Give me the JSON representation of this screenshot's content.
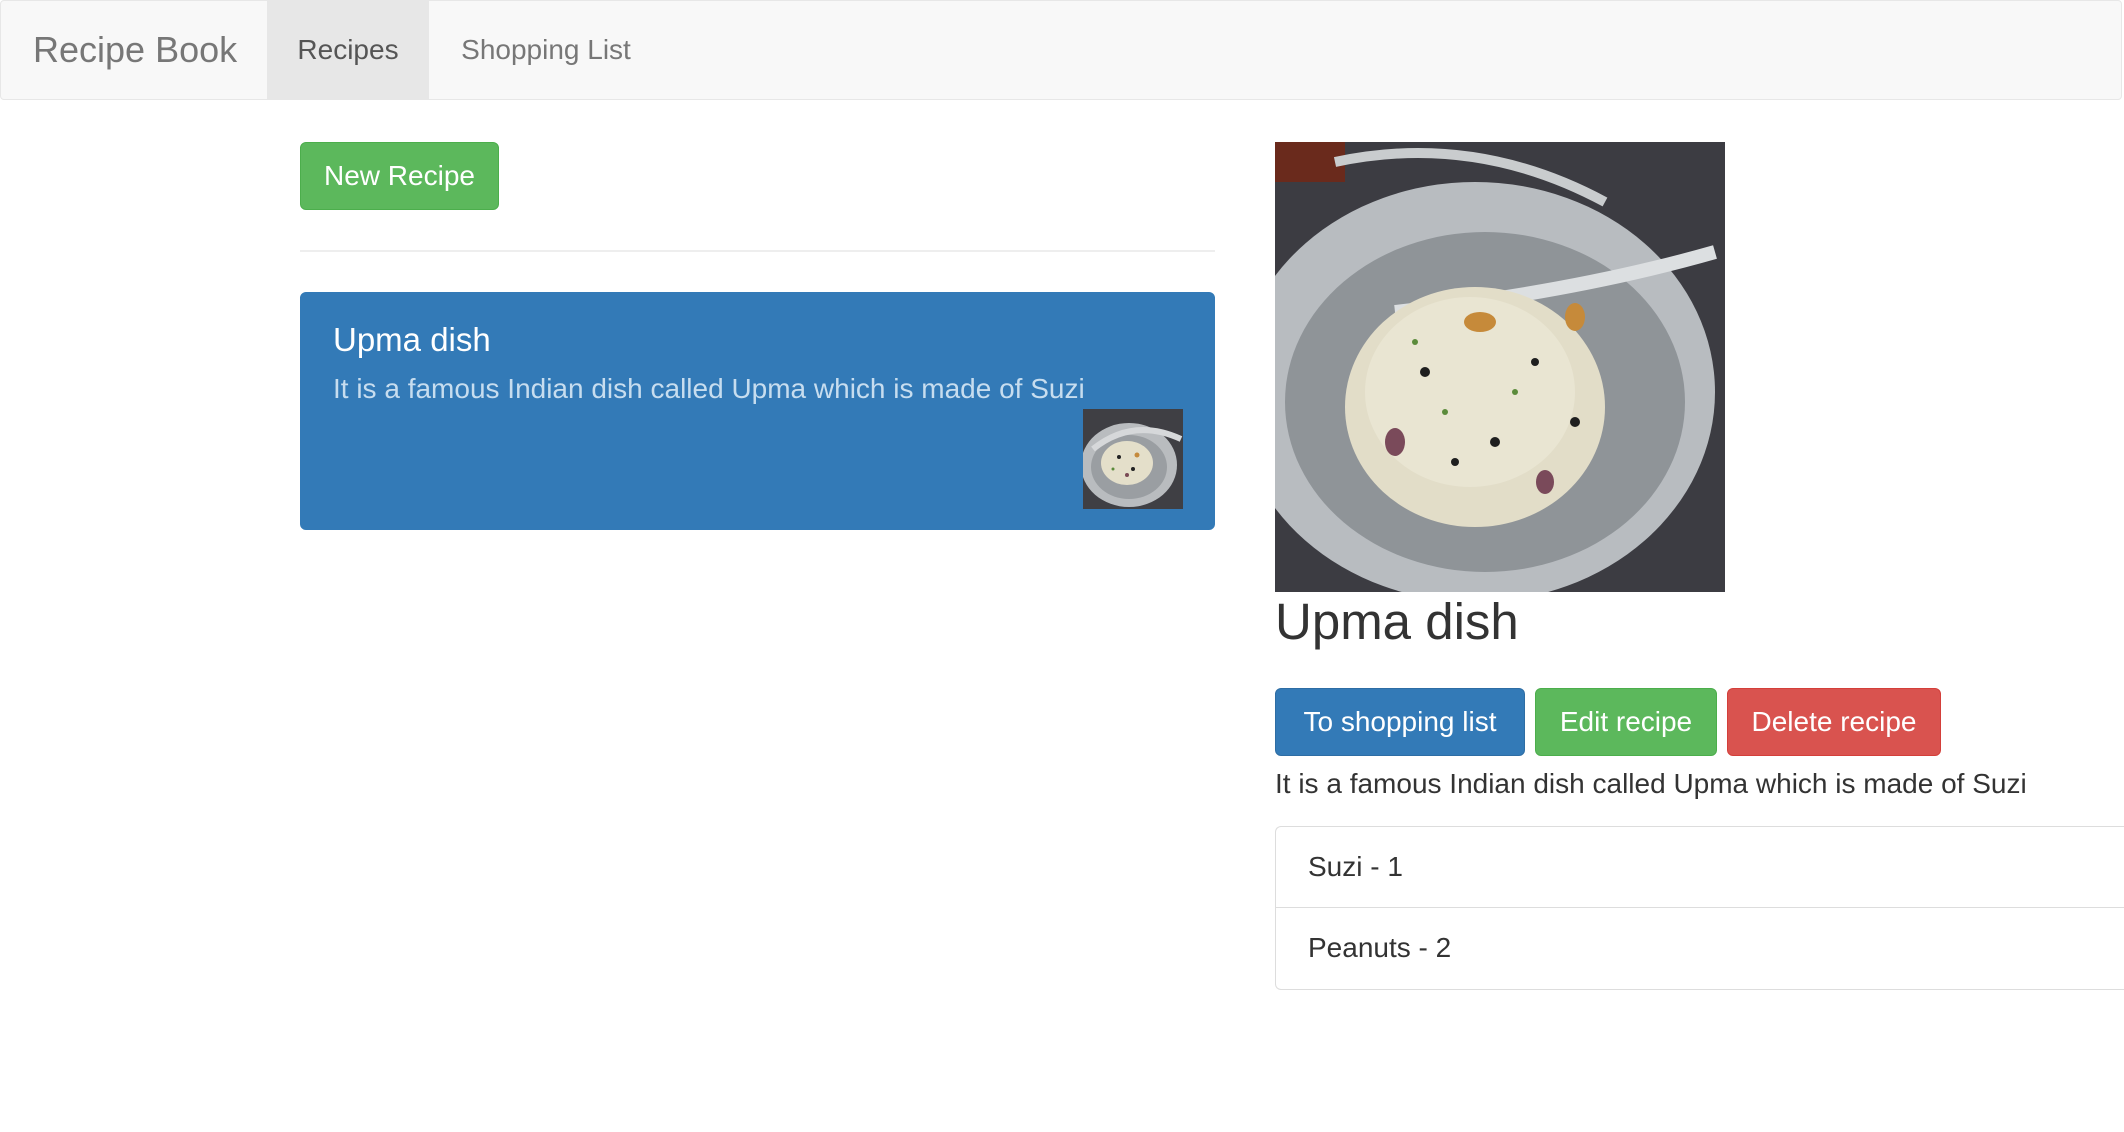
{
  "navbar": {
    "brand": "Recipe Book",
    "items": [
      {
        "label": "Recipes",
        "active": true
      },
      {
        "label": "Shopping List",
        "active": false
      }
    ]
  },
  "recipe_list": {
    "new_button_label": "New Recipe",
    "items": [
      {
        "name": "Upma dish",
        "description": "It is a famous Indian dish called Upma which is made of Suzi"
      }
    ]
  },
  "recipe_detail": {
    "name": "Upma dish",
    "buttons": {
      "to_shopping_list": "To shopping list",
      "edit": "Edit recipe",
      "delete": "Delete recipe"
    },
    "description": "It is a famous Indian dish called Upma which is made of Suzi",
    "ingredients": [
      {
        "label": "Suzi - 1"
      },
      {
        "label": "Peanuts - 2"
      }
    ]
  },
  "colors": {
    "primary": "#337ab7",
    "success": "#5cb85c",
    "danger": "#d9534f",
    "navbar_bg": "#f8f8f8"
  }
}
